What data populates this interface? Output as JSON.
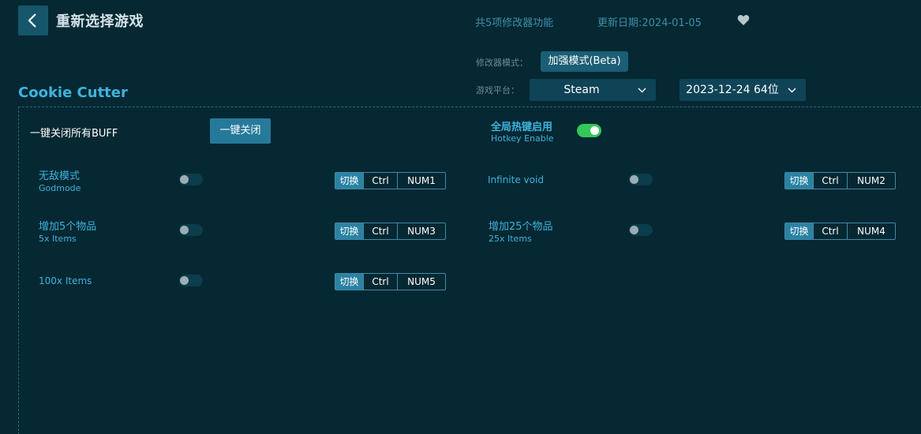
{
  "header": {
    "title": "重新选择游戏",
    "feature_count": "共5项修改器功能",
    "update_date": "更新日期:2024-01-05"
  },
  "mode": {
    "label": "修改器模式：",
    "value": "加强模式(Beta)"
  },
  "platform": {
    "label": "游戏平台：",
    "value": "Steam",
    "version": "2023-12-24 64位"
  },
  "game": {
    "name": "Cookie Cutter"
  },
  "controls": {
    "close_all_label": "一键关闭所有BUFF",
    "close_all_button": "一键关闭",
    "hotkey_enable_cn": "全局热键启用",
    "hotkey_enable_en": "Hotkey Enable",
    "hotkey_enabled": true
  },
  "hotkey_labels": {
    "switch": "切换",
    "ctrl": "Ctrl"
  },
  "cheats": [
    {
      "cn": "无敌模式",
      "en": "Godmode",
      "key": "NUM1",
      "enabled": false
    },
    {
      "cn": "",
      "en": "Infinite void",
      "key": "NUM2",
      "enabled": false
    },
    {
      "cn": "增加5个物品",
      "en": "5x Items",
      "key": "NUM3",
      "enabled": false
    },
    {
      "cn": "增加25个物品",
      "en": "25x Items",
      "key": "NUM4",
      "enabled": false
    },
    {
      "cn": "",
      "en": "100x Items",
      "key": "NUM5",
      "enabled": false
    }
  ],
  "colors": {
    "background": "#052833",
    "accent": "#3fb3dc",
    "toggle_on": "#34c759",
    "button": "#267a99"
  }
}
